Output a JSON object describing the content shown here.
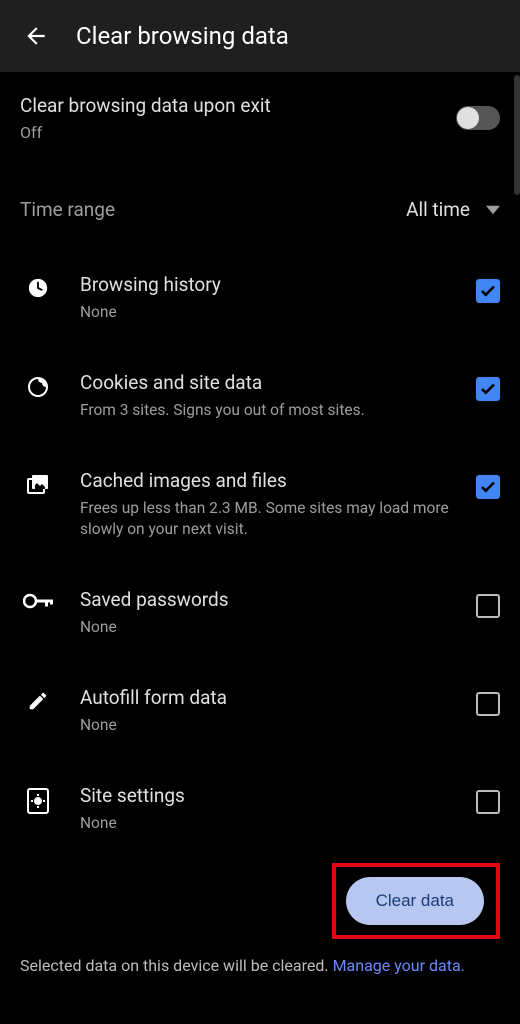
{
  "appbar": {
    "title": "Clear browsing data"
  },
  "exitRow": {
    "title": "Clear browsing data upon exit",
    "status": "Off",
    "enabled": false
  },
  "timeRange": {
    "label": "Time range",
    "value": "All time"
  },
  "options": [
    {
      "id": "history",
      "icon": "clock",
      "title": "Browsing history",
      "subtitle": "None",
      "checked": true
    },
    {
      "id": "cookies",
      "icon": "cookie",
      "title": "Cookies and site data",
      "subtitle": "From 3 sites. Signs you out of most sites.",
      "checked": true
    },
    {
      "id": "cache",
      "icon": "image",
      "title": "Cached images and files",
      "subtitle": "Frees up less than 2.3 MB. Some sites may load more slowly on your next visit.",
      "checked": true
    },
    {
      "id": "passwords",
      "icon": "key",
      "title": "Saved passwords",
      "subtitle": "None",
      "checked": false
    },
    {
      "id": "autofill",
      "icon": "pencil",
      "title": "Autofill form data",
      "subtitle": "None",
      "checked": false
    },
    {
      "id": "sitesettings",
      "icon": "sitegear",
      "title": "Site settings",
      "subtitle": "None",
      "checked": false
    }
  ],
  "action": {
    "label": "Clear data"
  },
  "footer": {
    "text": "Selected data on this device will be cleared. ",
    "linkText": "Manage your data."
  }
}
